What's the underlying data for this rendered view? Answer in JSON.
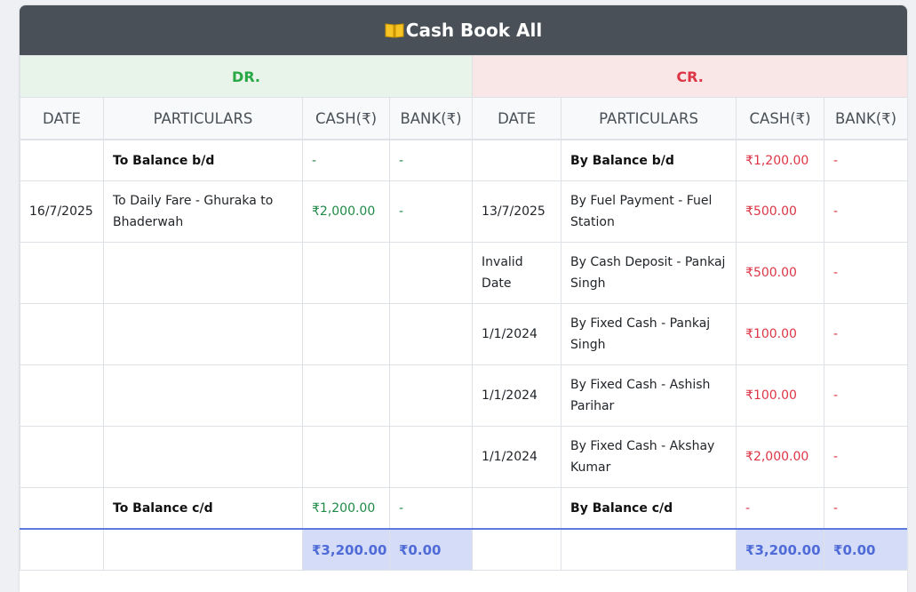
{
  "header": {
    "title": "Cash Book All",
    "icon": "open-book-icon"
  },
  "sides": {
    "dr": "DR.",
    "cr": "CR."
  },
  "columns": [
    "DATE",
    "PARTICULARS",
    "CASH(₹)",
    "BANK(₹)",
    "DATE",
    "PARTICULARS",
    "CASH(₹)",
    "BANK(₹)"
  ],
  "rows": [
    {
      "dr_date": "",
      "dr_part": "To Balance b/d",
      "dr_cash": "-",
      "dr_bank": "-",
      "cr_date": "",
      "cr_part": "By Balance b/d",
      "cr_cash": "₹1,200.00",
      "cr_bank": "-"
    },
    {
      "dr_date": "16/7/2025",
      "dr_part": "To Daily Fare - Ghuraka to Bhaderwah",
      "dr_cash": "₹2,000.00",
      "dr_bank": "-",
      "cr_date": "13/7/2025",
      "cr_part": "By Fuel Payment - Fuel Station",
      "cr_cash": "₹500.00",
      "cr_bank": "-"
    },
    {
      "dr_date": "",
      "dr_part": "",
      "dr_cash": "",
      "dr_bank": "",
      "cr_date": "Invalid Date",
      "cr_part": "By Cash Deposit - Pankaj Singh",
      "cr_cash": "₹500.00",
      "cr_bank": "-"
    },
    {
      "dr_date": "",
      "dr_part": "",
      "dr_cash": "",
      "dr_bank": "",
      "cr_date": "1/1/2024",
      "cr_part": "By Fixed Cash - Pankaj Singh",
      "cr_cash": "₹100.00",
      "cr_bank": "-"
    },
    {
      "dr_date": "",
      "dr_part": "",
      "dr_cash": "",
      "dr_bank": "",
      "cr_date": "1/1/2024",
      "cr_part": "By Fixed Cash - Ashish Parihar",
      "cr_cash": "₹100.00",
      "cr_bank": "-"
    },
    {
      "dr_date": "",
      "dr_part": "",
      "dr_cash": "",
      "dr_bank": "",
      "cr_date": "1/1/2024",
      "cr_part": "By Fixed Cash - Akshay Kumar",
      "cr_cash": "₹2,000.00",
      "cr_bank": "-"
    },
    {
      "dr_date": "",
      "dr_part": "To Balance c/d",
      "dr_cash": "₹1,200.00",
      "dr_bank": "-",
      "cr_date": "",
      "cr_part": "By Balance c/d",
      "cr_cash": "-",
      "cr_bank": "-"
    }
  ],
  "totals": {
    "dr_cash": "₹3,200.00",
    "dr_bank": "₹0.00",
    "cr_cash": "₹3,200.00",
    "cr_bank": "₹0.00"
  },
  "colors": {
    "header_bg": "#495057",
    "dr": "#28a745",
    "cr": "#dc3545",
    "total": "#4f6bd8"
  }
}
